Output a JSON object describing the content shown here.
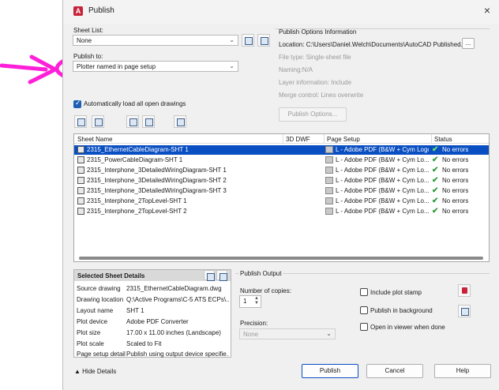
{
  "window": {
    "title": "Publish",
    "close_glyph": "×",
    "app_icon_letter": "A"
  },
  "sheet_list": {
    "label": "Sheet List:",
    "value": "None"
  },
  "publish_to": {
    "label": "Publish to:",
    "value": "Plotter named in page setup"
  },
  "auto_load": {
    "label": "Automatically load all open drawings",
    "checked": true
  },
  "publish_options": {
    "title": "Publish Options Information",
    "location": "Location: C:\\Users\\Daniel.Welch\\Documents\\AutoCAD Published...",
    "location_button": "...",
    "file_type": "File type: Single-sheet file",
    "naming": "Naming:N/A",
    "layer_information": "Layer information: Include",
    "merge_control": "Merge control: Lines overwrite",
    "button": "Publish Options..."
  },
  "table": {
    "headers": {
      "sheet_name": "Sheet Name",
      "dwf": "3D DWF",
      "page_setup": "Page Setup",
      "status": "Status"
    },
    "rows": [
      {
        "sheet": "2315_EthernetCableDiagram-SHT 1",
        "page_setup": "L - Adobe PDF (B&W + Cym Logo",
        "status": "No errors"
      },
      {
        "sheet": "2315_PowerCableDiagram-SHT 1",
        "page_setup": "L - Adobe PDF (B&W + Cym Lo...",
        "status": "No errors"
      },
      {
        "sheet": "2315_Interphone_3DetailedWiringDiagram-SHT 1",
        "page_setup": "L - Adobe PDF (B&W + Cym Lo...",
        "status": "No errors"
      },
      {
        "sheet": "2315_Interphone_3DetailedWiringDiagram-SHT 2",
        "page_setup": "L - Adobe PDF (B&W + Cym Lo...",
        "status": "No errors"
      },
      {
        "sheet": "2315_Interphone_3DetailedWiringDiagram-SHT 3",
        "page_setup": "L - Adobe PDF (B&W + Cym Lo...",
        "status": "No errors"
      },
      {
        "sheet": "2315_Interphone_2TopLevel-SHT 1",
        "page_setup": "L - Adobe PDF (B&W + Cym Lo...",
        "status": "No errors"
      },
      {
        "sheet": "2315_Interphone_2TopLevel-SHT 2",
        "page_setup": "L - Adobe PDF (B&W + Cym Lo...",
        "status": "No errors"
      }
    ]
  },
  "details": {
    "title": "Selected Sheet Details",
    "labels": {
      "source_drawing": "Source drawing",
      "drawing_location": "Drawing location",
      "layout_name": "Layout name",
      "plot_device": "Plot device",
      "plot_size": "Plot size",
      "plot_scale": "Plot scale",
      "page_setup_detail": "Page setup detail"
    },
    "values": {
      "source_drawing": "2315_EthernetCableDiagram.dwg",
      "drawing_location": "Q:\\Active Programs\\C-5 ATS ECPs\\...",
      "layout_name": "SHT 1",
      "plot_device": "Adobe PDF Converter",
      "plot_size": "17.00 x 11.00 inches (Landscape)",
      "plot_scale": "Scaled to Fit",
      "page_setup_detail": "Publish using output device specifie..."
    }
  },
  "publish_output": {
    "title": "Publish Output",
    "copies_label": "Number of copies:",
    "copies_value": "1",
    "precision_label": "Precision:",
    "precision_value": "None",
    "include_plot_stamp": "Include plot stamp",
    "publish_in_background": "Publish in background",
    "open_in_viewer": "Open in viewer when done"
  },
  "footer": {
    "hide_details": "Hide Details",
    "publish": "Publish",
    "cancel": "Cancel",
    "help": "Help"
  },
  "colors": {
    "selection": "#0a4fc2",
    "status_ok": "#2e9b3a",
    "annotation": "#ff1fd8"
  }
}
